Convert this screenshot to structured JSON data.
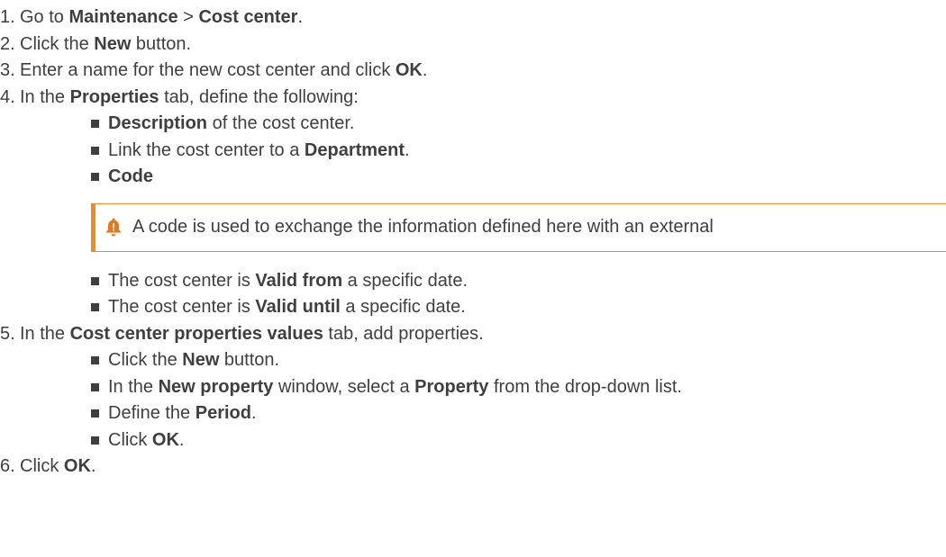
{
  "steps": [
    {
      "num": "1.",
      "parts": [
        {
          "t": "Go to ",
          "b": false
        },
        {
          "t": "Maintenance",
          "b": true
        },
        {
          "t": " > ",
          "b": false
        },
        {
          "t": "Cost center",
          "b": true
        },
        {
          "t": ".",
          "b": false
        }
      ]
    },
    {
      "num": "2.",
      "parts": [
        {
          "t": "Click the ",
          "b": false
        },
        {
          "t": "New",
          "b": true
        },
        {
          "t": " button.",
          "b": false
        }
      ]
    },
    {
      "num": "3.",
      "parts": [
        {
          "t": "Enter a name for the new cost center and click ",
          "b": false
        },
        {
          "t": "OK",
          "b": true
        },
        {
          "t": ".",
          "b": false
        }
      ]
    },
    {
      "num": "4.",
      "parts": [
        {
          "t": "In the ",
          "b": false
        },
        {
          "t": "Properties",
          "b": true
        },
        {
          "t": " tab, define the following:",
          "b": false
        }
      ],
      "sub": [
        {
          "parts": [
            {
              "t": "Description",
              "b": true
            },
            {
              "t": " of the cost center.",
              "b": false
            }
          ]
        },
        {
          "parts": [
            {
              "t": "Link the cost center to a ",
              "b": false
            },
            {
              "t": "Department",
              "b": true
            },
            {
              "t": ".",
              "b": false
            }
          ]
        },
        {
          "parts": [
            {
              "t": "Code",
              "b": true
            }
          ],
          "note": {
            "icon": "bell-icon",
            "text": "A code is used to exchange the information defined here with an external"
          }
        },
        {
          "parts": [
            {
              "t": "The cost center is ",
              "b": false
            },
            {
              "t": "Valid from",
              "b": true
            },
            {
              "t": " a specific date.",
              "b": false
            }
          ]
        },
        {
          "parts": [
            {
              "t": "The cost center is ",
              "b": false
            },
            {
              "t": "Valid until",
              "b": true
            },
            {
              "t": " a specific date.",
              "b": false
            }
          ]
        }
      ]
    },
    {
      "num": "5.",
      "parts": [
        {
          "t": "In the ",
          "b": false
        },
        {
          "t": "Cost center properties values",
          "b": true
        },
        {
          "t": " tab, add properties.",
          "b": false
        }
      ],
      "sub": [
        {
          "parts": [
            {
              "t": "Click the ",
              "b": false
            },
            {
              "t": "New",
              "b": true
            },
            {
              "t": " button.",
              "b": false
            }
          ]
        },
        {
          "parts": [
            {
              "t": "In the ",
              "b": false
            },
            {
              "t": "New property",
              "b": true
            },
            {
              "t": " window, select a ",
              "b": false
            },
            {
              "t": "Property",
              "b": true
            },
            {
              "t": " from the drop-down list.",
              "b": false
            }
          ]
        },
        {
          "parts": [
            {
              "t": "Define the ",
              "b": false
            },
            {
              "t": "Period",
              "b": true
            },
            {
              "t": ".",
              "b": false
            }
          ]
        },
        {
          "parts": [
            {
              "t": "Click ",
              "b": false
            },
            {
              "t": "OK",
              "b": true
            },
            {
              "t": ".",
              "b": false
            }
          ]
        }
      ]
    },
    {
      "num": "6.",
      "parts": [
        {
          "t": "Click ",
          "b": false
        },
        {
          "t": "OK",
          "b": true
        },
        {
          "t": ".",
          "b": false
        }
      ]
    }
  ],
  "colors": {
    "text": "#3f3f3f",
    "accent": "#f08a24",
    "bell": "#e8761b"
  }
}
